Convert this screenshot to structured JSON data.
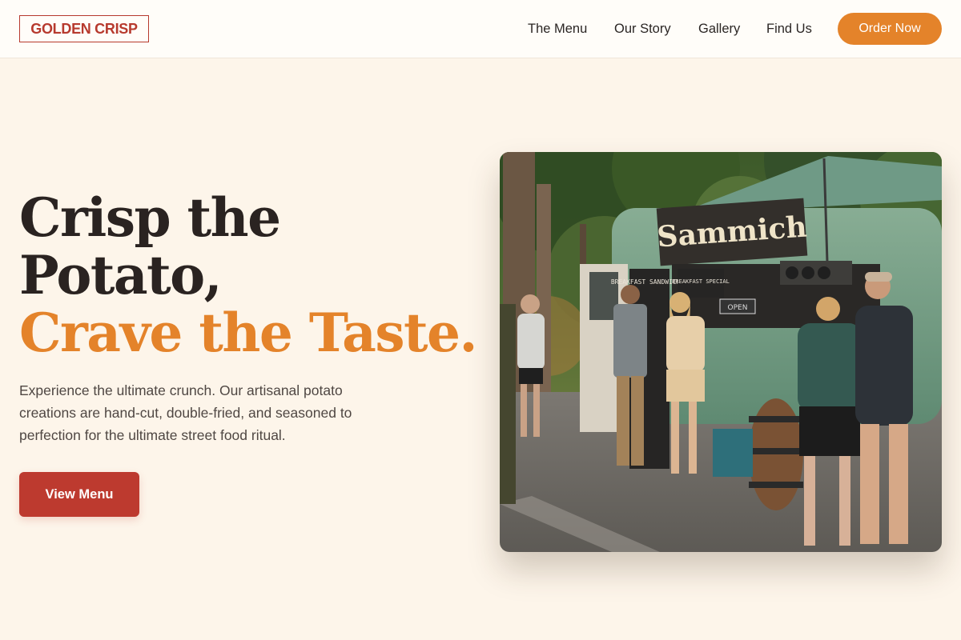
{
  "brand": {
    "logo_text": "GOLDEN CRISP",
    "color": "#b73a2e"
  },
  "nav": {
    "links": [
      "The Menu",
      "Our Story",
      "Gallery",
      "Find Us"
    ],
    "order_label": "Order Now"
  },
  "hero": {
    "headline_line1": "Crisp the",
    "headline_line2": "Potato,",
    "headline_accent": "Crave the Taste.",
    "description": "Experience the ultimate crunch. Our artisanal potato creations are hand-cut, double-fried, and seasoned to perfection for the ultimate street food ritual.",
    "cta_label": "View Menu"
  },
  "photo": {
    "truck_sign": "Sammich",
    "board_left": "BREAKFAST SANDWICHES",
    "board_right": "BREAKFAST SPECIAL",
    "sign_small": "OPEN"
  },
  "colors": {
    "background": "#fdf5ea",
    "accent_orange": "#e4832a",
    "cta_red": "#bd3a2f",
    "text_dark": "#2a2321"
  }
}
